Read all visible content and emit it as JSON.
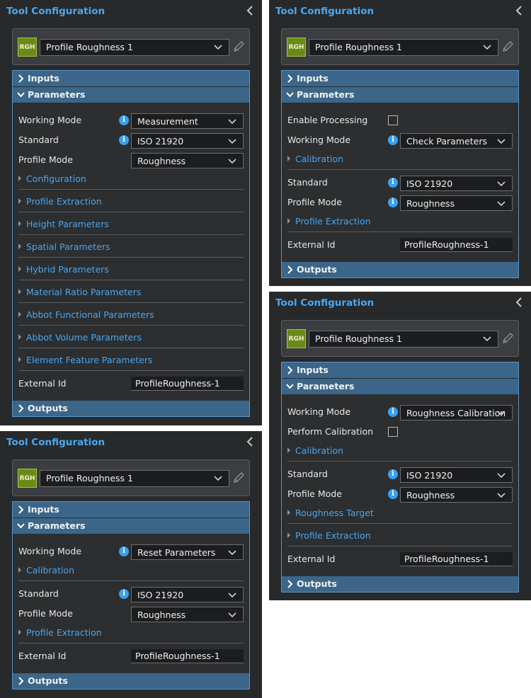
{
  "common": {
    "panel_title": "Tool Configuration",
    "tool_badge": "RGH",
    "tool_name": "Profile Roughness 1",
    "inputs_label": "Inputs",
    "parameters_label": "Parameters",
    "outputs_label": "Outputs",
    "working_mode_label": "Working Mode",
    "standard_label": "Standard",
    "profile_mode_label": "Profile Mode",
    "external_id_label": "External Id",
    "external_id_value": "ProfileRoughness-1",
    "standard_value": "ISO 21920",
    "profile_mode_value": "Roughness",
    "calibration_link": "Calibration",
    "profile_extraction_link": "Profile Extraction"
  },
  "panel_measurement": {
    "working_mode_value": "Measurement",
    "groups": [
      "Configuration",
      "Profile Extraction",
      "Height Parameters",
      "Spatial Parameters",
      "Hybrid Parameters",
      "Material Ratio Parameters",
      "Abbot Functional Parameters",
      "Abbot Volume Parameters",
      "Element Feature Parameters"
    ]
  },
  "panel_check": {
    "enable_processing_label": "Enable Processing",
    "working_mode_value": "Check Parameters"
  },
  "panel_reset": {
    "working_mode_value": "Reset Parameters"
  },
  "panel_calibration": {
    "working_mode_value": "Roughness Calibration",
    "perform_calibration_label": "Perform Calibration",
    "roughness_target_link": "Roughness Target"
  },
  "colors": {
    "accent": "#4aa8f0",
    "header": "#3b6689",
    "panel": "#27292b",
    "badge": "#6a8a18"
  }
}
